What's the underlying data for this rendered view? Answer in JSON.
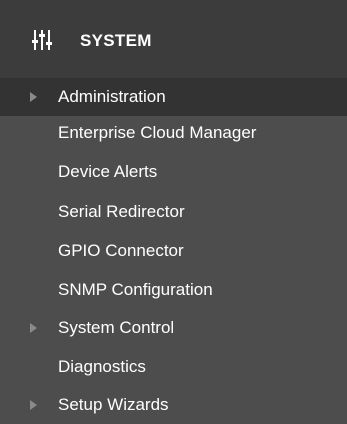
{
  "header": {
    "title": "SYSTEM",
    "icon": "sliders-icon"
  },
  "menu": {
    "items": [
      {
        "label": "Administration",
        "has_submenu": true,
        "active": true
      },
      {
        "label": "Enterprise Cloud Manager",
        "has_submenu": false,
        "active": false
      },
      {
        "label": "Device Alerts",
        "has_submenu": false,
        "active": false
      },
      {
        "label": "Serial Redirector",
        "has_submenu": false,
        "active": false
      },
      {
        "label": "GPIO Connector",
        "has_submenu": false,
        "active": false
      },
      {
        "label": "SNMP Configuration",
        "has_submenu": false,
        "active": false
      },
      {
        "label": "System Control",
        "has_submenu": true,
        "active": false
      },
      {
        "label": "Diagnostics",
        "has_submenu": false,
        "active": false
      },
      {
        "label": "Setup Wizards",
        "has_submenu": true,
        "active": false
      }
    ]
  },
  "colors": {
    "header_bg": "#3c3c3c",
    "panel_bg": "#4d4d4d",
    "active_bg": "#333333",
    "text": "#ffffff",
    "arrow": "#8a8a8a"
  }
}
